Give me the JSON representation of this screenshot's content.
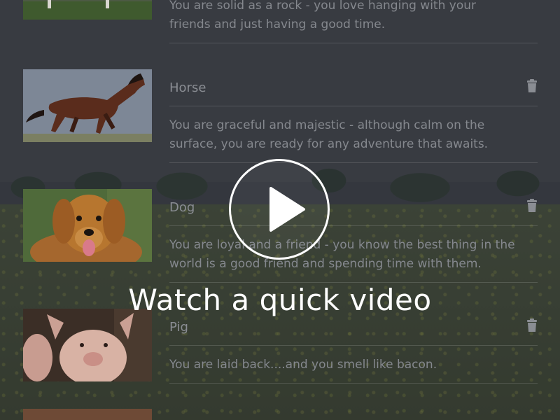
{
  "items": [
    {
      "name": "",
      "description_lines": [
        "You are solid as a rock - you love hanging with your",
        "friends and just having a good time."
      ],
      "thumb_icon": "animal-photo"
    },
    {
      "name": "Horse",
      "description_lines": [
        "You are graceful and majestic - although calm on the",
        "surface, you are ready for any adventure that awaits."
      ],
      "thumb_icon": "horse-photo"
    },
    {
      "name": "Dog",
      "description_lines": [
        "You are loyal and a friend - you know the best thing in the",
        "world is a good friend and spending time with them."
      ],
      "thumb_icon": "dog-photo"
    },
    {
      "name": "Pig",
      "description_lines": [
        "You are laid back....and you smell like bacon."
      ],
      "thumb_icon": "pig-photo"
    }
  ],
  "video": {
    "caption": "Watch a quick video",
    "icon": "play-icon"
  },
  "colors": {
    "overlay": "#3b3e45",
    "text_muted": "#85888e",
    "accent": "#ffffff"
  }
}
